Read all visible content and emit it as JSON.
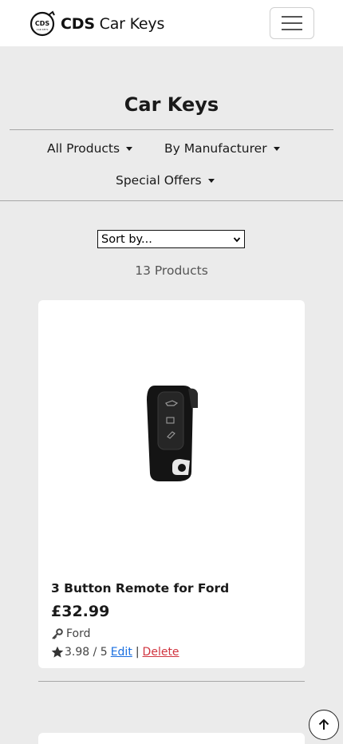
{
  "navbar": {
    "brand_bold": "CDS",
    "brand_rest": " Car Keys",
    "logo_text": "CDS",
    "logo_subtext": "CAR KEYS",
    "menu_icon": "hamburger-icon"
  },
  "page": {
    "title": "Car Keys"
  },
  "filters": {
    "all_products": "All Products",
    "by_manufacturer": "By Manufacturer",
    "special_offers": "Special Offers"
  },
  "sort": {
    "selected": "Sort by..."
  },
  "results": {
    "count_text": "13 Products"
  },
  "products": [
    {
      "title": "3 Button Remote for Ford",
      "price": "£32.99",
      "brand": "Ford",
      "rating": "3.98 / 5",
      "edit_label": "Edit",
      "separator": "|",
      "delete_label": "Delete"
    }
  ],
  "colors": {
    "background": "#ebebeb",
    "edit_link": "#1a6fe0",
    "delete_link": "#d0343f"
  },
  "icons": {
    "back_to_top": "arrow-up-icon",
    "brand": "key-icon",
    "rating": "star-icon"
  }
}
